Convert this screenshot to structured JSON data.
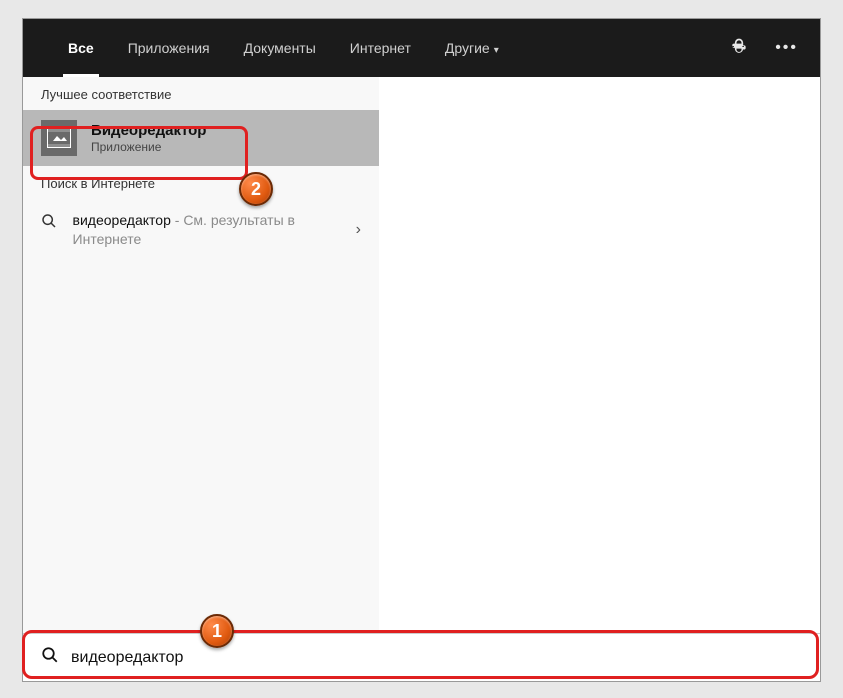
{
  "tabs": {
    "all": "Все",
    "apps": "Приложения",
    "docs": "Документы",
    "web": "Интернет",
    "more": "Другие"
  },
  "sections": {
    "bestMatch": "Лучшее соответствие",
    "webSearch": "Поиск в Интернете"
  },
  "bestMatch": {
    "title": "Видеоредактор",
    "subtitle": "Приложение"
  },
  "webResult": {
    "query": "видеоредактор",
    "suffix": " - См. результаты в Интернете"
  },
  "search": {
    "value": "видеоредактор"
  },
  "annotations": {
    "step1": "1",
    "step2": "2"
  }
}
